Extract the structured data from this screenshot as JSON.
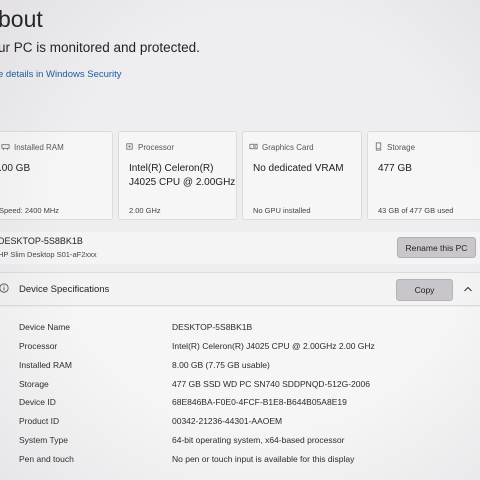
{
  "header": {
    "title": "bout",
    "status": "ur PC is monitored and protected.",
    "link": "e details in Windows Security"
  },
  "cards": [
    {
      "label": "Installed RAM",
      "icon": "ram-icon",
      "value": ".00 GB",
      "sub": "Speed: 2400 MHz"
    },
    {
      "label": "Processor",
      "icon": "processor-icon",
      "value": "Intel(R) Celeron(R) J4025 CPU @ 2.00GHz",
      "value_line1": "Intel(R) Celeron(R)",
      "value_line2": "J4025 CPU @ 2.00GHz",
      "sub": "2.00 GHz"
    },
    {
      "label": "Graphics Card",
      "icon": "graphics-card-icon",
      "value": "No dedicated VRAM",
      "sub": "No GPU installed"
    },
    {
      "label": "Storage",
      "icon": "storage-icon",
      "value": "477 GB",
      "sub": "43 GB of 477 GB used"
    }
  ],
  "device": {
    "name": "DESKTOP-5S8BK1B",
    "model": "HP Slim Desktop S01-aF2xxx",
    "rename_label": "Rename this PC"
  },
  "specs": {
    "title": "Device Specifications",
    "copy_label": "Copy",
    "rows": [
      {
        "label": "Device Name",
        "value": "DESKTOP-5S8BK1B"
      },
      {
        "label": "Processor",
        "value": "Intel(R) Celeron(R) J4025 CPU @ 2.00GHz   2.00 GHz"
      },
      {
        "label": "Installed RAM",
        "value": "8.00 GB (7.75 GB usable)"
      },
      {
        "label": "Storage",
        "value": "477 GB SSD WD PC SN740 SDDPNQD-512G-2006"
      },
      {
        "label": "Device ID",
        "value": "68E846BA-F0E0-4FCF-B1E8-B644B05A8E19"
      },
      {
        "label": "Product ID",
        "value": "00342-21236-44301-AAOEM"
      },
      {
        "label": "System Type",
        "value": "64-bit operating system, x64-based processor"
      },
      {
        "label": "Pen and touch",
        "value": "No pen or touch input is available for this display"
      }
    ]
  }
}
